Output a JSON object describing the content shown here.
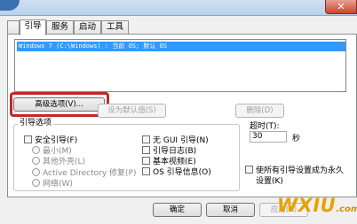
{
  "window": {
    "close_glyph": "✕"
  },
  "tabs": [
    {
      "label": "引导"
    },
    {
      "label": "服务"
    },
    {
      "label": "启动"
    },
    {
      "label": "工具"
    }
  ],
  "os_list": {
    "items": [
      "Windows 7 (C:\\Windows) : 当前 OS; 默认 OS"
    ]
  },
  "buttons": {
    "advanced": "高级选项(V)...",
    "set_default": "设为默认值(S)",
    "delete": "删除(D)",
    "ok": "确定",
    "cancel": "取消",
    "apply": "应用(A)"
  },
  "boot_options": {
    "legend": "引导选项",
    "safe_boot": "安全引导(F)",
    "minimal": "最小(M)",
    "alternate_shell": "其他外壳(L)",
    "ad_repair": "Active Directory 修复(P)",
    "network": "网络(W)",
    "no_gui": "无 GUI 引导(N)",
    "boot_log": "引导日志(B)",
    "base_video": "基本视频(E)",
    "os_boot_info": "OS 引导信息(O)"
  },
  "timeout": {
    "label": "超时(T):",
    "value": "30",
    "unit": "秒"
  },
  "permanent": {
    "label_line1": "使所有引导设置成为永久",
    "label_line2": "设置(K)"
  },
  "watermark": {
    "main": "WXIU",
    "sub": ".com"
  }
}
